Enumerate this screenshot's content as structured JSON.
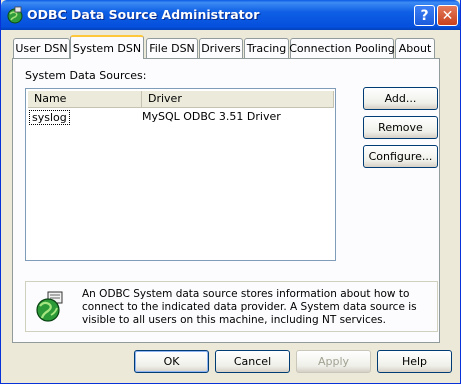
{
  "window": {
    "title": "ODBC Data Source Administrator",
    "help_button": "?",
    "close_button": "✕"
  },
  "tabs": [
    {
      "label": "User DSN",
      "active": false
    },
    {
      "label": "System DSN",
      "active": true
    },
    {
      "label": "File DSN",
      "active": false
    },
    {
      "label": "Drivers",
      "active": false
    },
    {
      "label": "Tracing",
      "active": false
    },
    {
      "label": "Connection Pooling",
      "active": false
    },
    {
      "label": "About",
      "active": false
    }
  ],
  "system_dsn": {
    "group_label": "System Data Sources:",
    "columns": [
      "Name",
      "Driver"
    ],
    "rows": [
      {
        "name": "syslog",
        "driver": "MySQL ODBC 3.51 Driver",
        "selected": true
      }
    ],
    "buttons": {
      "add": "Add...",
      "remove": "Remove",
      "configure": "Configure..."
    },
    "info_text": "An ODBC System data source stores information about how to connect to the indicated data provider.  A System data source is visible to all users on this machine, including NT services."
  },
  "footer": {
    "ok": "OK",
    "cancel": "Cancel",
    "apply": "Apply",
    "help": "Help"
  },
  "icons": {
    "title_icon": "odbc-globe-icon",
    "info_icon": "odbc-globe-icon"
  },
  "colors": {
    "titlebar": "#0550dd",
    "window_bg": "#ece9d8",
    "active_tab_accent": "#ffc83c"
  }
}
